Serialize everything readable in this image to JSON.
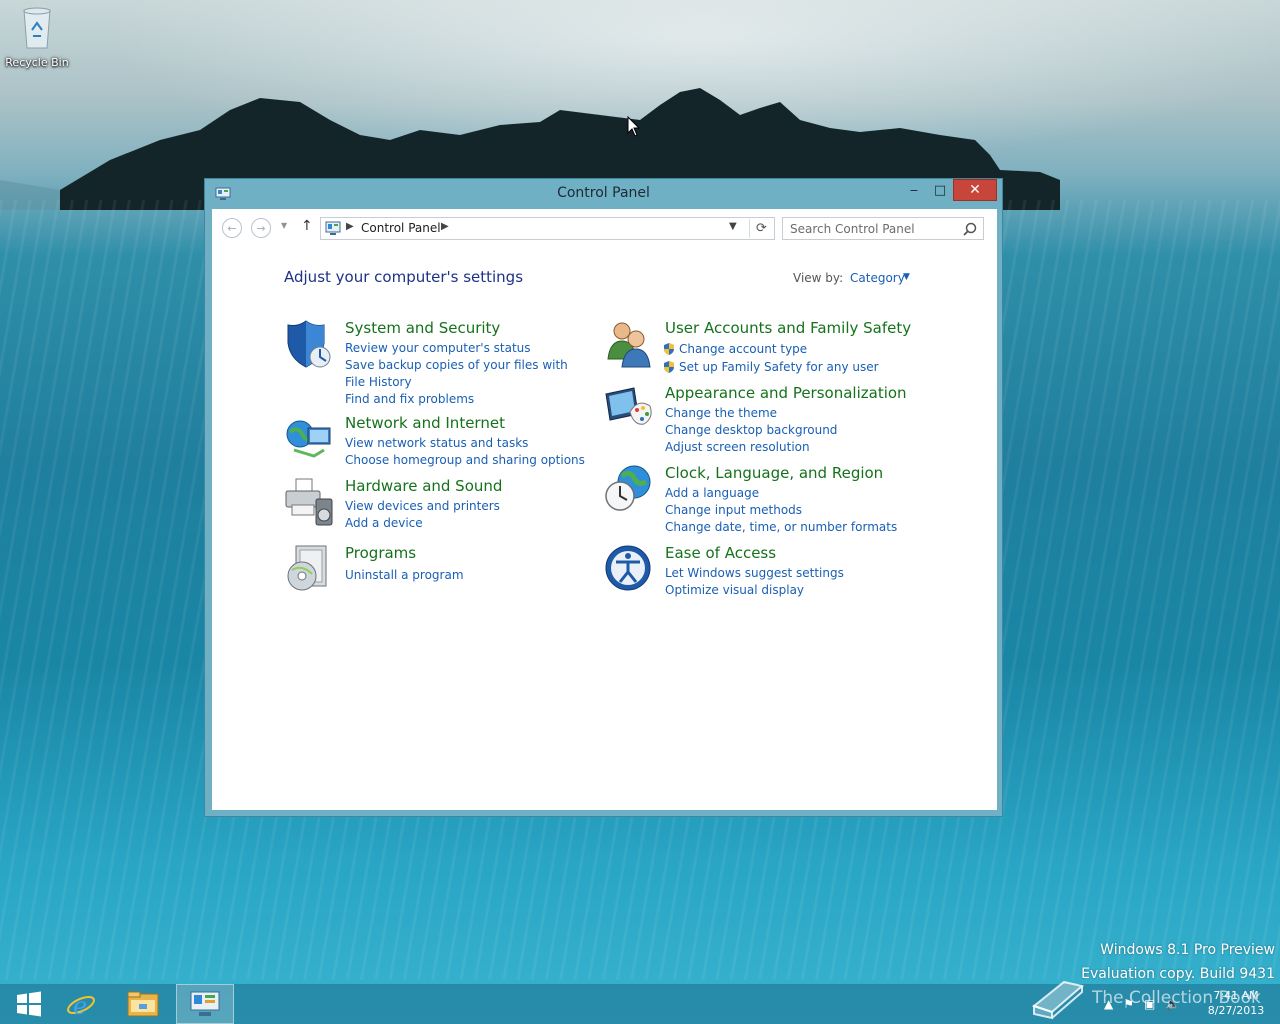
{
  "desktop": {
    "recycle_bin_label": "Recycle Bin"
  },
  "window": {
    "title": "Control Panel",
    "minimize": "‒",
    "maximize": "□",
    "close": "✕"
  },
  "nav": {
    "back": "←",
    "forward": "→",
    "up": "↑",
    "breadcrumb": [
      "Control Panel"
    ],
    "search_placeholder": "Search Control Panel"
  },
  "content": {
    "heading": "Adjust your computer's settings",
    "view_by_label": "View by:",
    "view_by_value": "Category",
    "categories_left": [
      {
        "title": "System and Security",
        "icon": "shield-icon",
        "links": [
          "Review your computer's status",
          "Save backup copies of your files with File History",
          "Find and fix problems"
        ]
      },
      {
        "title": "Network and Internet",
        "icon": "network-globe-icon",
        "links": [
          "View network status and tasks",
          "Choose homegroup and sharing options"
        ]
      },
      {
        "title": "Hardware and Sound",
        "icon": "printer-speaker-icon",
        "links": [
          "View devices and printers",
          "Add a device"
        ]
      },
      {
        "title": "Programs",
        "icon": "programs-disc-icon",
        "links": [
          "Uninstall a program"
        ]
      }
    ],
    "categories_right": [
      {
        "title": "User Accounts and Family Safety",
        "icon": "users-icon",
        "links": [
          "Change account type",
          "Set up Family Safety for any user"
        ]
      },
      {
        "title": "Appearance and Personalization",
        "icon": "monitor-palette-icon",
        "links": [
          "Change the theme",
          "Change desktop background",
          "Adjust screen resolution"
        ]
      },
      {
        "title": "Clock, Language, and Region",
        "icon": "globe-clock-icon",
        "links": [
          "Add a language",
          "Change input methods",
          "Change date, time, or number formats"
        ]
      },
      {
        "title": "Ease of Access",
        "icon": "ease-of-access-icon",
        "links": [
          "Let Windows suggest settings",
          "Optimize visual display"
        ]
      }
    ]
  },
  "watermark": {
    "line1": "Windows 8.1 Pro Preview",
    "line2": "Evaluation copy. Build 9431",
    "overlay": "The Collection Book"
  },
  "taskbar": {
    "time": "7:41 AM",
    "date": "8/27/2013"
  },
  "colors": {
    "link": "#1a5fb4",
    "category_title": "#15721b",
    "heading": "#1e3287",
    "close_button": "#c7453a",
    "window_frame": "#6fb0c4"
  }
}
